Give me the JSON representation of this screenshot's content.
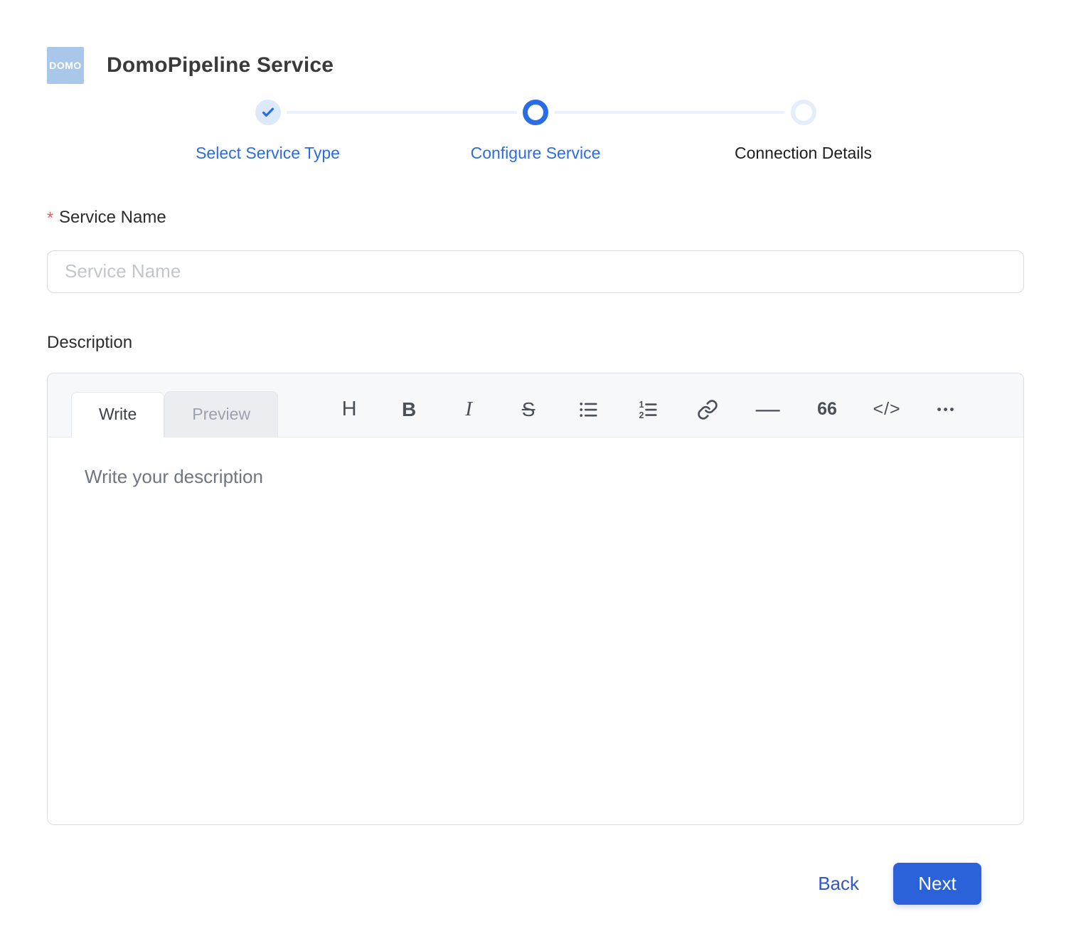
{
  "header": {
    "logo_text": "DOMO",
    "title": "DomoPipeline Service"
  },
  "stepper": {
    "steps": [
      {
        "label": "Select Service Type",
        "state": "completed"
      },
      {
        "label": "Configure Service",
        "state": "active"
      },
      {
        "label": "Connection Details",
        "state": "upcoming"
      }
    ]
  },
  "form": {
    "service_name": {
      "required_marker": "*",
      "label": "Service Name",
      "placeholder": "Service Name",
      "value": ""
    },
    "description_label": "Description"
  },
  "editor": {
    "tabs": {
      "write": "Write",
      "preview": "Preview"
    },
    "toolbar": {
      "heading": "H",
      "bold": "B",
      "italic": "I",
      "strikethrough": "S",
      "unordered_list": "unordered-list-icon",
      "ordered_list": "ordered-list-icon",
      "link": "link-icon",
      "horizontal_rule": "—",
      "quote": "66",
      "code": "</>",
      "more": "•••"
    },
    "placeholder": "Write your description",
    "value": ""
  },
  "footer": {
    "back_label": "Back",
    "next_label": "Next"
  },
  "colors": {
    "accent_blue": "#2a6ce3",
    "button_blue": "#2c62d9",
    "back_link_blue": "#3157cb",
    "logo_blue": "#a9c7e8",
    "required_red": "#f4544c",
    "upcoming_ring": "#e3edfb",
    "connector": "#e9f1fb"
  }
}
